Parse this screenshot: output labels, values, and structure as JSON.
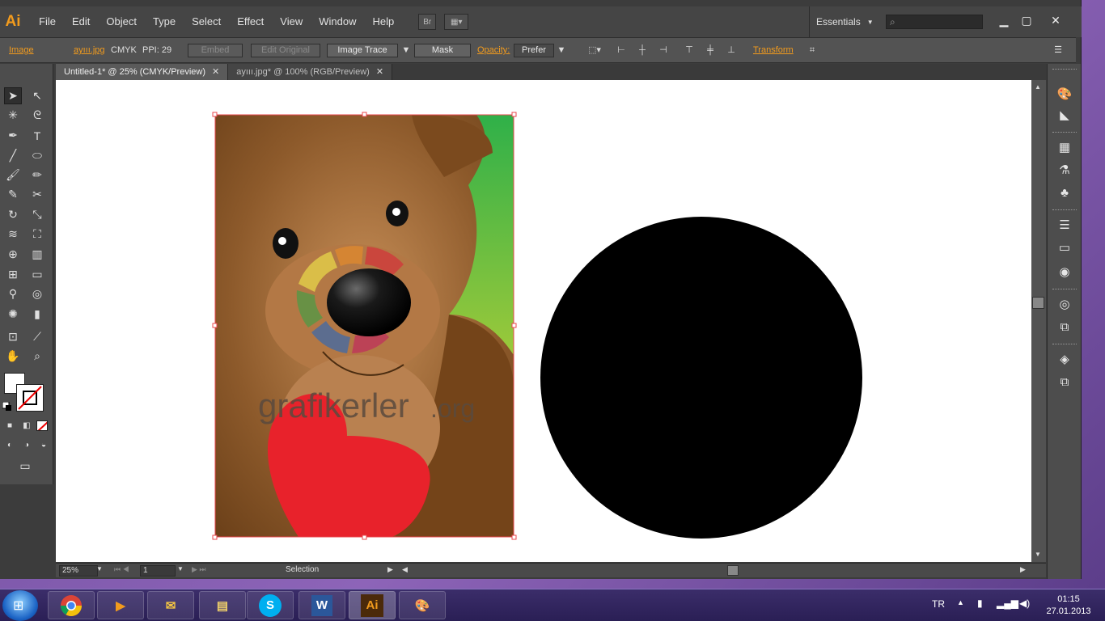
{
  "app": {
    "logo": "Ai",
    "menu": [
      "File",
      "Edit",
      "Object",
      "Type",
      "Select",
      "Effect",
      "View",
      "Window",
      "Help"
    ],
    "bridge_label": "Br",
    "workspace": "Essentials",
    "search_placeholder": ""
  },
  "control_bar": {
    "object_type": "Image",
    "file_link": "ayııı.jpg",
    "color_mode": "CMYK",
    "ppi": "PPI: 29",
    "embed": "Embed",
    "edit_original": "Edit Original",
    "image_trace": "Image Trace",
    "mask": "Mask",
    "opacity_label": "Opacity:",
    "opacity_value": "Prefer",
    "transform": "Transform"
  },
  "tabs": [
    {
      "label": "Untitled-1* @ 25% (CMYK/Preview)",
      "active": true
    },
    {
      "label": "ayııı.jpg* @ 100% (RGB/Preview)",
      "active": false
    }
  ],
  "canvas": {
    "watermark_main": "grafikerler",
    "watermark_tld": ".org"
  },
  "status_bar": {
    "zoom": "25%",
    "artboard": "1",
    "tool": "Selection"
  },
  "taskbar": {
    "language": "TR",
    "time": "01:15",
    "date": "27.01.2013",
    "apps": [
      {
        "icon": "chrome-icon"
      },
      {
        "icon": "media-player-icon"
      },
      {
        "icon": "outlook-icon"
      },
      {
        "icon": "file-explorer-icon"
      },
      {
        "icon": "skype-icon",
        "label": "S"
      },
      {
        "icon": "word-icon",
        "label": "W"
      },
      {
        "icon": "illustrator-icon",
        "label": "Ai"
      },
      {
        "icon": "paint-icon"
      }
    ]
  },
  "colors": {
    "accent": "#f29b1d",
    "panel": "#535353",
    "selection": "#e8474d"
  }
}
